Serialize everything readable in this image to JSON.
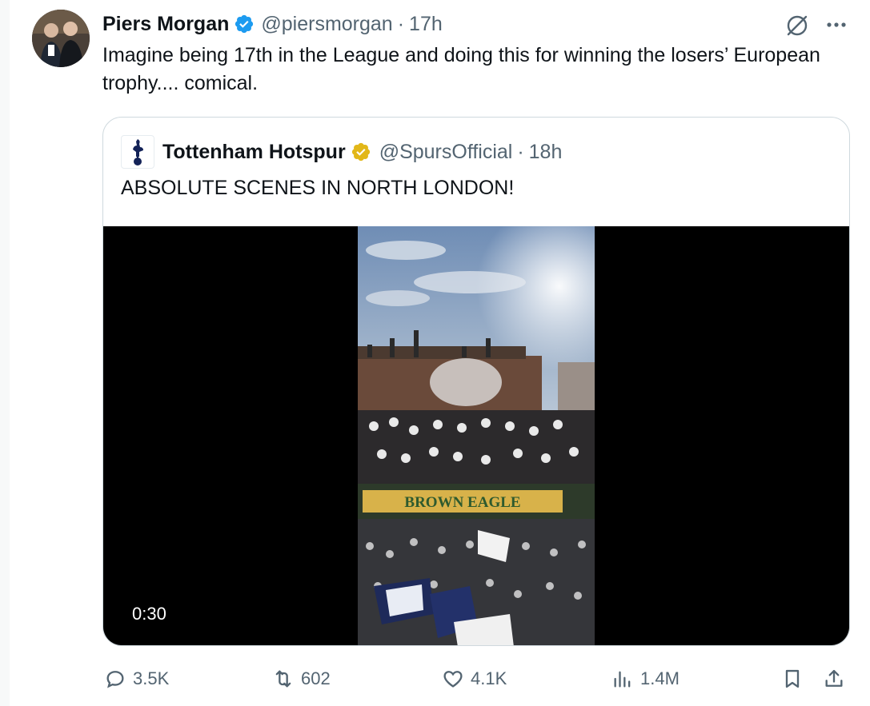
{
  "tweet": {
    "display_name": "Piers Morgan",
    "handle": "@piersmorgan",
    "separator": "·",
    "time": "17h",
    "text": "Imagine being 17th in the League and doing this for winning the losers’ European trophy.... comical."
  },
  "quoted_tweet": {
    "display_name": "Tottenham Hotspur",
    "handle": "@SpursOfficial",
    "separator": "·",
    "time": "18h",
    "text": "ABSOLUTE SCENES IN NORTH LONDON!",
    "video": {
      "duration": "0:30",
      "pub_sign": "BROWN EAGLE"
    }
  },
  "actions": {
    "replies": "3.5K",
    "reposts": "602",
    "likes": "4.1K",
    "views": "1.4M"
  },
  "icons": {
    "verified_color": "#1d9bf0",
    "gold_verified_color": "#e2b719",
    "action_color": "#536471"
  }
}
